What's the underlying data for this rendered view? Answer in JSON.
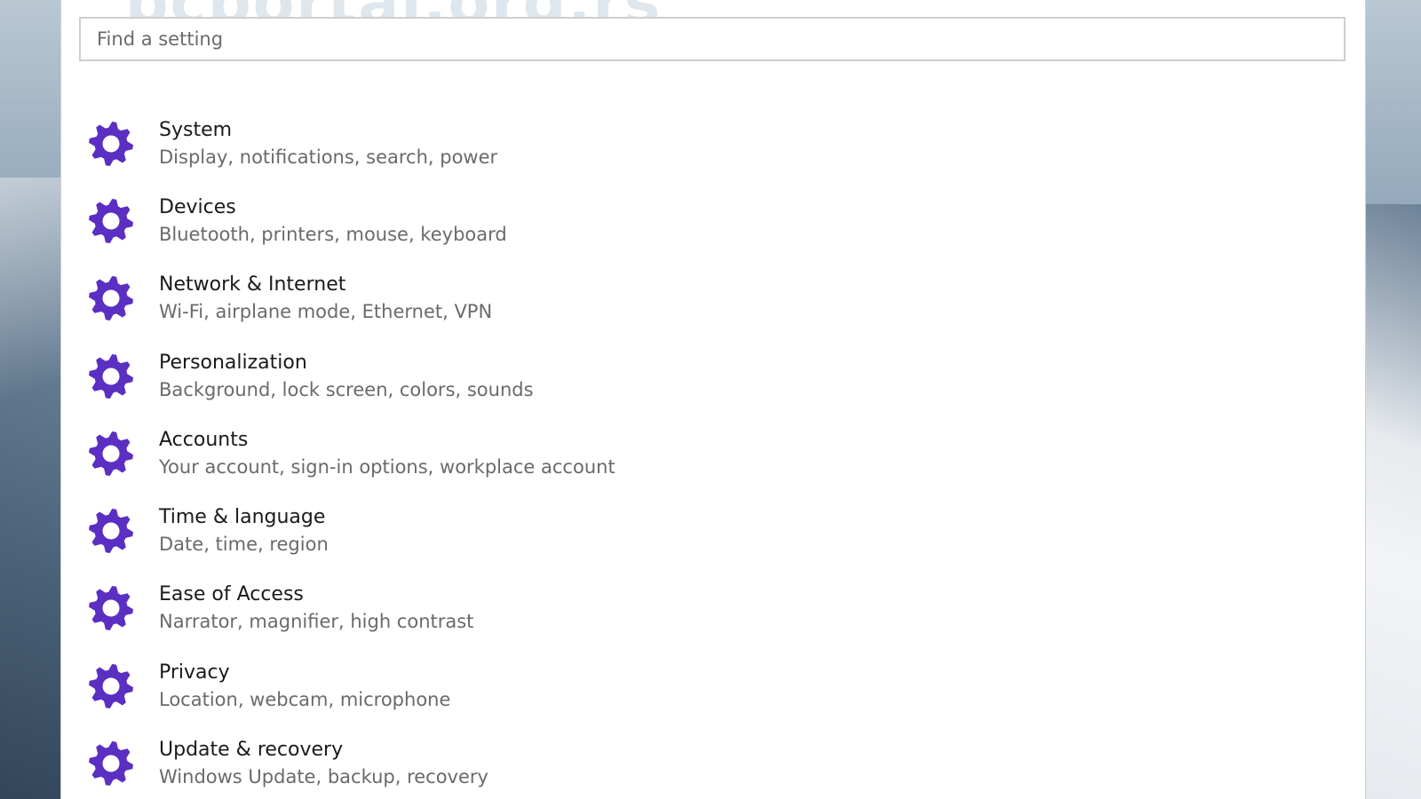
{
  "search": {
    "placeholder": "Find a setting"
  },
  "watermark": {
    "text": "pcportal.org.rs"
  },
  "icon_color": "#5a2fc2",
  "categories": [
    {
      "title": "System",
      "description": "Display, notifications, search, power",
      "icon": "gear-icon"
    },
    {
      "title": "Devices",
      "description": "Bluetooth, printers, mouse, keyboard",
      "icon": "gear-icon"
    },
    {
      "title": "Network & Internet",
      "description": "Wi-Fi, airplane mode, Ethernet, VPN",
      "icon": "gear-icon"
    },
    {
      "title": "Personalization",
      "description": "Background, lock screen, colors, sounds",
      "icon": "gear-icon"
    },
    {
      "title": "Accounts",
      "description": "Your account, sign-in options, workplace account",
      "icon": "gear-icon"
    },
    {
      "title": "Time & language",
      "description": "Date, time, region",
      "icon": "gear-icon"
    },
    {
      "title": "Ease of Access",
      "description": "Narrator, magnifier, high contrast",
      "icon": "gear-icon"
    },
    {
      "title": "Privacy",
      "description": "Location, webcam, microphone",
      "icon": "gear-icon"
    },
    {
      "title": "Update & recovery",
      "description": "Windows Update, backup, recovery",
      "icon": "gear-icon"
    }
  ]
}
